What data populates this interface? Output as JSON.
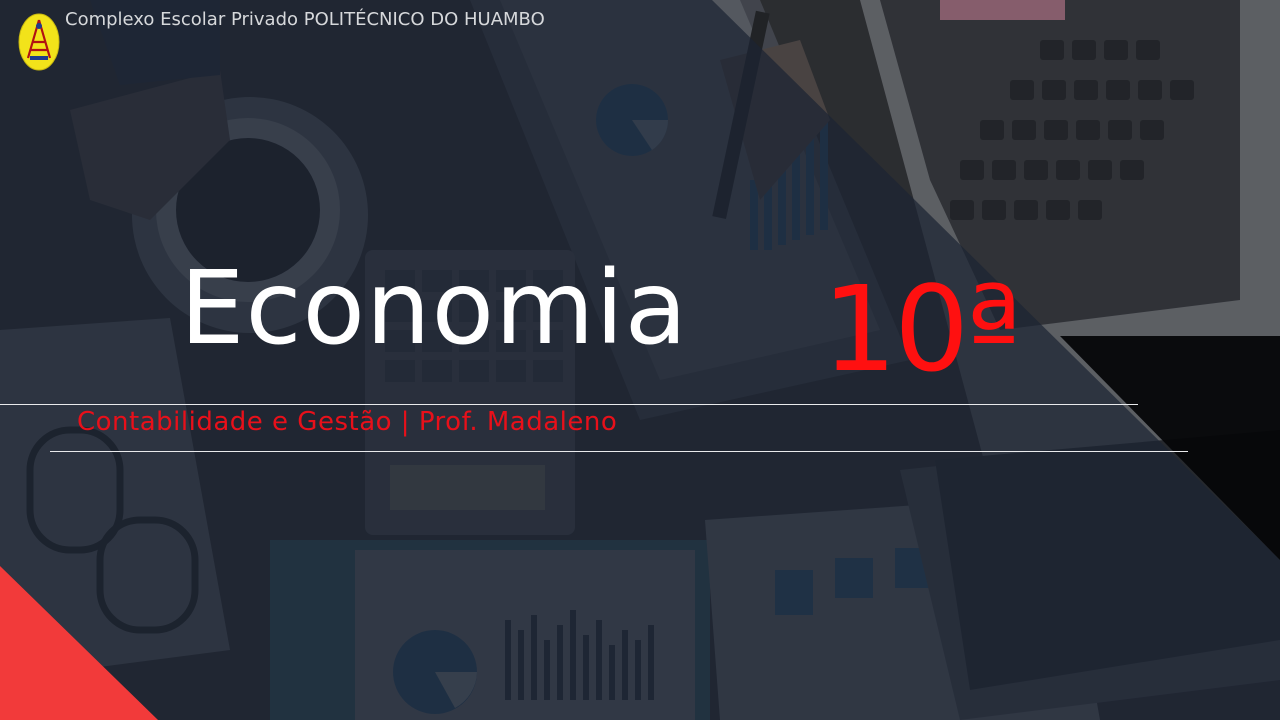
{
  "header": {
    "school_name": "Complexo Escolar Privado POLITÉCNICO DO HUAMBO"
  },
  "title": {
    "subject": "Economia",
    "grade": "10ª"
  },
  "subtitle": {
    "text": "Contabilidade e Gestão | Prof. Madaleno"
  },
  "colors": {
    "accent_red": "#ff1010",
    "subtitle_red": "#e8101a",
    "title_white": "#ffffff",
    "panel_navy": "#1c2433",
    "logo_yellow": "#f2e31a"
  },
  "icons": {
    "logo": "school-logo-icon"
  }
}
